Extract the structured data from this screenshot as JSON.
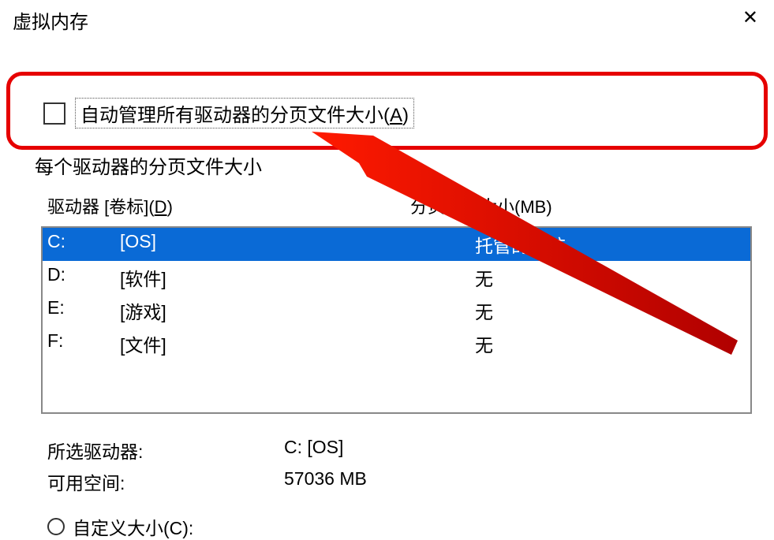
{
  "title": "虚拟内存",
  "auto_manage": {
    "label_prefix": "自动管理所有驱动器的分页文件大小(",
    "letter": "A",
    "label_suffix": ")"
  },
  "section_header": "每个驱动器的分页文件大小",
  "columns": {
    "drive_prefix": "驱动器 [卷标](",
    "drive_letter": "D",
    "drive_suffix": ")",
    "size": "分页文件大小(MB)"
  },
  "drives": [
    {
      "drive": "C:",
      "label": "[OS]",
      "size": "托管的系统",
      "selected": true
    },
    {
      "drive": "D:",
      "label": "[软件]",
      "size": "无",
      "selected": false
    },
    {
      "drive": "E:",
      "label": "[游戏]",
      "size": "无",
      "selected": false
    },
    {
      "drive": "F:",
      "label": "[文件]",
      "size": "无",
      "selected": false
    }
  ],
  "info": {
    "selected_drive_label": "所选驱动器:",
    "selected_drive_value": "C:  [OS]",
    "free_space_label": "可用空间:",
    "free_space_value": "57036 MB"
  },
  "radio": {
    "custom_label": "自定义大小(C):"
  },
  "colors": {
    "highlight": "#e60000",
    "selection": "#0a6ad6"
  }
}
